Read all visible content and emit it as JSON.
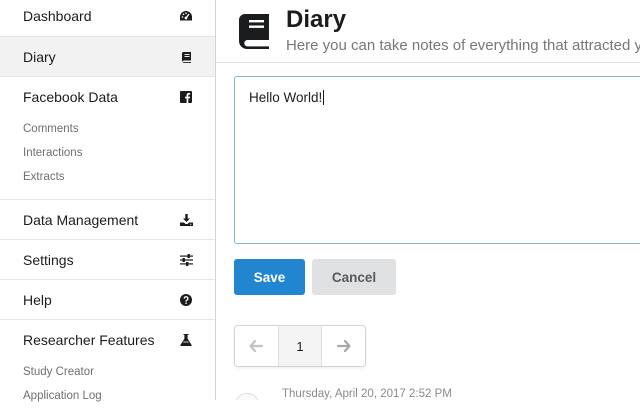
{
  "sidebar": {
    "dashboard": {
      "label": "Dashboard",
      "icon": "dashboard-icon"
    },
    "diary": {
      "label": "Diary",
      "icon": "book-icon"
    },
    "facebook": {
      "label": "Facebook Data",
      "icon": "facebook-icon",
      "sub": [
        "Comments",
        "Interactions",
        "Extracts"
      ]
    },
    "data_management": {
      "label": "Data Management",
      "icon": "download-icon"
    },
    "settings": {
      "label": "Settings",
      "icon": "sliders-icon"
    },
    "help": {
      "label": "Help",
      "icon": "question-circle-icon"
    },
    "researcher": {
      "label": "Researcher Features",
      "icon": "flask-icon",
      "sub": [
        "Study Creator",
        "Application Log"
      ]
    }
  },
  "header": {
    "title": "Diary",
    "subtitle": "Here you can take notes of everything that attracted your attention"
  },
  "editor": {
    "value": "Hello World!"
  },
  "actions": {
    "save": "Save",
    "cancel": "Cancel"
  },
  "pagination": {
    "current": "1"
  },
  "entry": {
    "date": "Thursday, April 20, 2017 2:52 PM"
  },
  "colors": {
    "primary": "#2185d0",
    "active_bg": "#f2f2f2",
    "editor_border": "#85b7d9"
  }
}
